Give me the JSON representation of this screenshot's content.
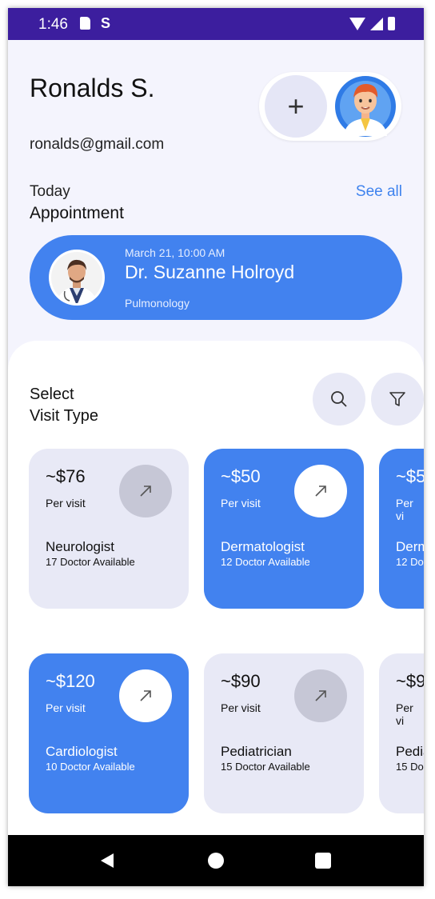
{
  "status": {
    "time": "1:46",
    "s_glyph": "S"
  },
  "profile": {
    "name": "Ronalds S.",
    "email": "ronalds@gmail.com"
  },
  "header": {
    "add_glyph": "+"
  },
  "appointment_section": {
    "today": "Today",
    "title": "Appointment",
    "see_all": "See all"
  },
  "appointment": {
    "date": "March 21, 10:00 AM",
    "doctor": "Dr. Suzanne Holroyd",
    "specialty": "Pulmonology"
  },
  "visit": {
    "title_line1": "Select",
    "title_line2": "Visit Type"
  },
  "cards": [
    {
      "price": "~$76",
      "per": "Per visit",
      "specialty": "Neurologist",
      "available": "17 Doctor Available",
      "style": "light"
    },
    {
      "price": "~$50",
      "per": "Per visit",
      "specialty": "Dermatologist",
      "available": "12 Doctor Available",
      "style": "blue"
    },
    {
      "price": "~$5",
      "per": "Per vi",
      "specialty": "Derm",
      "available": "12 Do",
      "style": "blue"
    },
    {
      "price": "~$120",
      "per": "Per visit",
      "specialty": "Cardiologist",
      "available": "10 Doctor Available",
      "style": "blue"
    },
    {
      "price": "~$90",
      "per": "Per visit",
      "specialty": "Pediatrician",
      "available": "15 Doctor Available",
      "style": "light"
    },
    {
      "price": "~$9",
      "per": "Per vi",
      "specialty": "Pedia",
      "available": "15 Do",
      "style": "light"
    }
  ],
  "icons": {
    "search": "search-icon",
    "filter": "filter-icon",
    "arrow": "arrow-up-right-icon",
    "back": "nav-back-icon",
    "home": "nav-home-icon",
    "recents": "nav-recents-icon"
  },
  "colors": {
    "accent": "#4282ef",
    "status_bar": "#3c1e9e",
    "background": "#f4f4fd",
    "card_light": "#e8e9f6"
  }
}
